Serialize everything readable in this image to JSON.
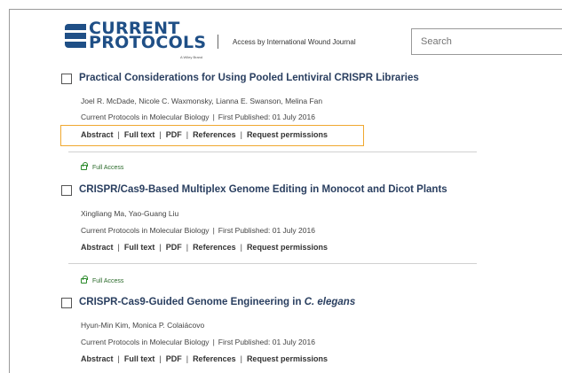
{
  "header": {
    "logo_line1": "CURRENT",
    "logo_line2": "PROTOCOLS",
    "logo_sub": "A Wiley Brand",
    "access_text": "Access by International Wound Journal",
    "search_placeholder": "Search"
  },
  "entries": [
    {
      "title": "Practical Considerations for Using Pooled Lentiviral CRISPR Libraries",
      "authors": "Joel R. McDade,  Nicole C. Waxmonsky,  Lianna E. Swanson,  Melina Fan",
      "journal": "Current Protocols in Molecular Biology",
      "published": "First Published:  01 July 2016",
      "links": [
        "Abstract",
        "Full text",
        "PDF",
        "References",
        "Request permissions"
      ]
    },
    {
      "access_label": "Full Access",
      "title": "CRISPR/Cas9-Based Multiplex Genome Editing in Monocot and Dicot Plants",
      "authors": "Xingliang Ma,  Yao-Guang Liu",
      "journal": "Current Protocols in Molecular Biology",
      "published": "First Published:  01 July 2016",
      "links": [
        "Abstract",
        "Full text",
        "PDF",
        "References",
        "Request permissions"
      ]
    },
    {
      "access_label": "Full Access",
      "title_main": "CRISPR-Cas9-Guided Genome Engineering in ",
      "title_italic": "C. elegans",
      "authors": "Hyun-Min Kim,  Monica P. Colaiácovo",
      "journal": "Current Protocols in Molecular Biology",
      "published": "First Published:  01 July 2016",
      "links": [
        "Abstract",
        "Full text",
        "PDF",
        "References",
        "Request permissions"
      ]
    }
  ],
  "colors": {
    "brand": "#1f4f86",
    "title": "#2a3f60",
    "highlight": "#f0a830",
    "access": "#2a8a2a"
  }
}
